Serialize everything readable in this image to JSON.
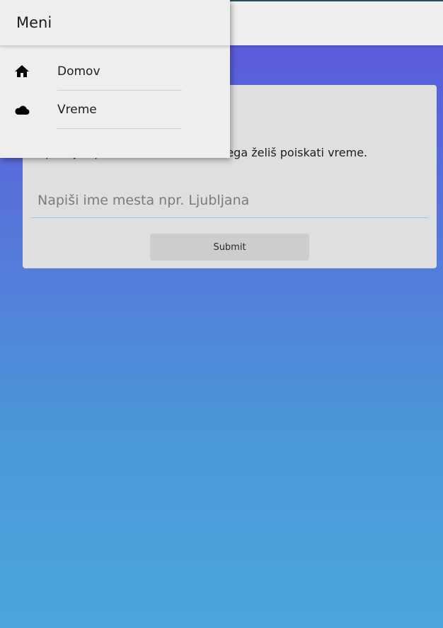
{
  "drawer": {
    "title": "Meni",
    "items": [
      {
        "label": "Domov",
        "icon": "home-icon"
      },
      {
        "label": "Vreme",
        "icon": "cloud-icon"
      }
    ]
  },
  "card": {
    "text": "Spodaj napiši ime mesta za katerega želiš poiskati vreme.",
    "input_placeholder": "Napiši ime mesta npr. Ljubljana",
    "input_value": "",
    "submit_label": "Submit"
  },
  "colors": {
    "background_top": "#5b55d9",
    "background_bottom": "#4aa6da",
    "card_bg": "#dfdfdf",
    "drawer_bg": "#eeeeee",
    "input_underline": "#8ec9ea"
  }
}
